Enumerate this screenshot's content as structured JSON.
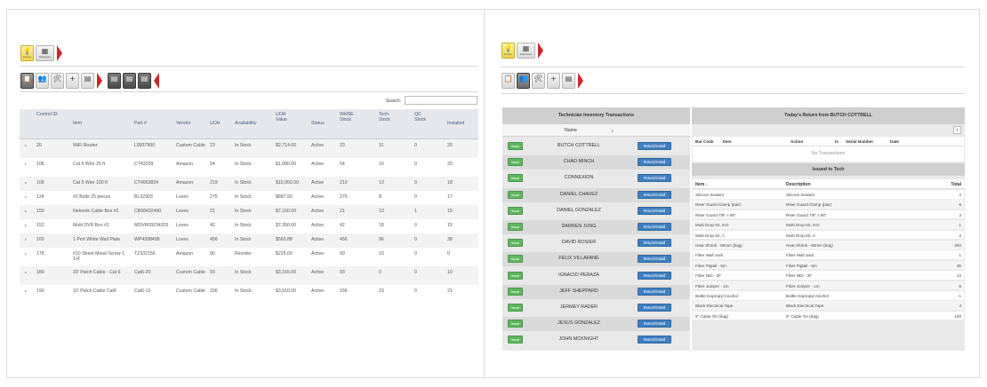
{
  "left": {
    "toolbar_top": [
      {
        "name": "finance-icon",
        "glyph": "💡",
        "caption": "Finance"
      },
      {
        "name": "warehouse-icon",
        "glyph": "▦",
        "caption": "Warehouse"
      }
    ],
    "toolbar_second": [
      {
        "name": "clipboard-icon",
        "glyph": "📋"
      },
      {
        "name": "technicians-icon",
        "glyph": "👥"
      },
      {
        "name": "tools-icon",
        "glyph": "🛠"
      },
      {
        "name": "add-icon",
        "glyph": "+"
      },
      {
        "name": "report-icon",
        "glyph": "▤"
      }
    ],
    "toolbar_third": [
      {
        "name": "report-a-icon",
        "glyph": "▤"
      },
      {
        "name": "report-b-icon",
        "glyph": "▤"
      },
      {
        "name": "report-c-icon",
        "glyph": "▤"
      }
    ],
    "search_label": "Search:",
    "columns": [
      "Control ID",
      "Item",
      "Part #",
      "Vendor",
      "UOH",
      "Availability",
      "UOH Value",
      "Status",
      "WHSE Stock",
      "Tech Stock",
      "QC Stock",
      "Installed"
    ],
    "rows": [
      [
        "20",
        "WiFi Router",
        "L9937990",
        "Custom Cable",
        "23",
        "In Stock",
        "$2,714.00",
        "Active",
        "23",
        "11",
        "0",
        "20"
      ],
      [
        "106",
        "Cat 5 Wire 25 ft",
        "CT43299",
        "Amazon",
        "54",
        "In Stock",
        "$1,080.00",
        "Active",
        "54",
        "16",
        "0",
        "20"
      ],
      [
        "109",
        "Cat 5 Wire 100 ft",
        "CT4003834",
        "Amazon",
        "219",
        "In Stock",
        "$10,950.00",
        "Active",
        "219",
        "13",
        "0",
        "18"
      ],
      [
        "124",
        "#2 Bolts 25 pieces",
        "BL32903",
        "Loves",
        "275",
        "In Stock",
        "$687.50",
        "Active",
        "275",
        "8",
        "0",
        "17"
      ],
      [
        "150",
        "Network Cable Box #1",
        "CB98432490",
        "Loves",
        "21",
        "In Stock",
        "$7,150.00",
        "Active",
        "21",
        "13",
        "1",
        "15"
      ],
      [
        "152",
        "Multi DVR Box #1",
        "MDVR09234329",
        "Loves",
        "42",
        "In Stock",
        "$7,350.00",
        "Active",
        "42",
        "18",
        "0",
        "15"
      ],
      [
        "160",
        "1 Port White Wall Plate",
        "WP4398498",
        "Loves",
        "456",
        "In Stock",
        "$560.88",
        "Active",
        "456",
        "96",
        "0",
        "38"
      ],
      [
        "178",
        "#10 Sheet Metal Screw 1 1/4'",
        "TZ332156",
        "Amazon",
        "90",
        "Reorder",
        "$225.00",
        "Active",
        "90",
        "10",
        "0",
        "0"
      ],
      [
        "189",
        "20' Patch Cable - Cat 6",
        "Cat6-20",
        "Custom Cable",
        "93",
        "In Stock",
        "$3,165.00",
        "Active",
        "93",
        "0",
        "0",
        "10"
      ],
      [
        "190",
        "10' Patch Cable Cat6",
        "Cat6-10",
        "Custom Cable",
        "156",
        "In Stock",
        "$3,510.00",
        "Active",
        "156",
        "23",
        "0",
        "21"
      ]
    ]
  },
  "right": {
    "toolbar_top": [
      {
        "name": "finance-icon",
        "glyph": "💡",
        "caption": "Finance"
      },
      {
        "name": "warehouse-icon",
        "glyph": "▦",
        "caption": "Warehouse"
      }
    ],
    "toolbar_second": [
      {
        "name": "clipboard-icon",
        "glyph": "📋"
      },
      {
        "name": "technicians-icon",
        "glyph": "👥"
      },
      {
        "name": "tools-icon",
        "glyph": "🛠"
      },
      {
        "name": "add-icon",
        "glyph": "+"
      },
      {
        "name": "report-icon",
        "glyph": "▤"
      }
    ],
    "tech_title": "Technician Inventory Transactions",
    "tech_col_name": "Name",
    "issue_label": "Issue",
    "return_label": "Return/Install",
    "technicians": [
      "BUTCH COTTRELL",
      "CHAD MINCH",
      "CONNEXION",
      "DANIEL CHAVEZ",
      "DANIEL GONZALEZ",
      "DARREN JUNG",
      "DAVID ROSIER",
      "FELIX VILLAFANE",
      "IGNACIO PERAZA",
      "JEFF SHEPPARD",
      "JERMEY RADER",
      "JESUS GONZALEZ",
      "JOHN MCKNIGHT"
    ],
    "return_title": "Today's Return from BUTCH COTTRELL",
    "plus_label": "+",
    "return_cols": [
      "Bar Code",
      "Item",
      "Action",
      "In",
      "Serial Number",
      "Date"
    ],
    "no_transactions": "No Transactions",
    "issued_title": "Issued to Tech",
    "issued_cols": [
      "Item ↓",
      "Description",
      "Total"
    ],
    "issued_rows": [
      [
        "Silcone Sealant",
        "Silcone Sealant",
        "2"
      ],
      [
        "Riser Guard Clamp (pair)",
        "Riser Guard Clamp (pair)",
        "6"
      ],
      [
        "Riser Guard 7/8\" x 90\"",
        "Riser Guard 7/8\" x 90\"",
        "3"
      ],
      [
        "Multi Drop Kit, 8-D",
        "Multi Drop Kit, 8-D",
        "1"
      ],
      [
        "Multi Drop Kit, A",
        "Multi Drop Kit, A",
        "2"
      ],
      [
        "Heat Shrink - 60mm (bag)",
        "Heat Shrink - 60mm (bag)",
        "200"
      ],
      [
        "Fiber Wall Jack",
        "Fiber Wall Jack",
        "1"
      ],
      [
        "Fiber Pigtail - 5m",
        "Fiber Pigtail - 5m",
        "25"
      ],
      [
        "Fiber NID - 2F",
        "Fiber NID - 2F",
        "14"
      ],
      [
        "Fiber Jumper - 1m",
        "Fiber Jumper - 1m",
        "5"
      ],
      [
        "Bottle Isopropyl Alcohol",
        "Bottle Isopropyl Alcohol",
        "1"
      ],
      [
        "Black Electrical Tape",
        "Black Electrical Tape",
        "4"
      ],
      [
        "8\" Cable Tie (bag)",
        "8\" Cable Tie (bag)",
        "100"
      ]
    ]
  }
}
